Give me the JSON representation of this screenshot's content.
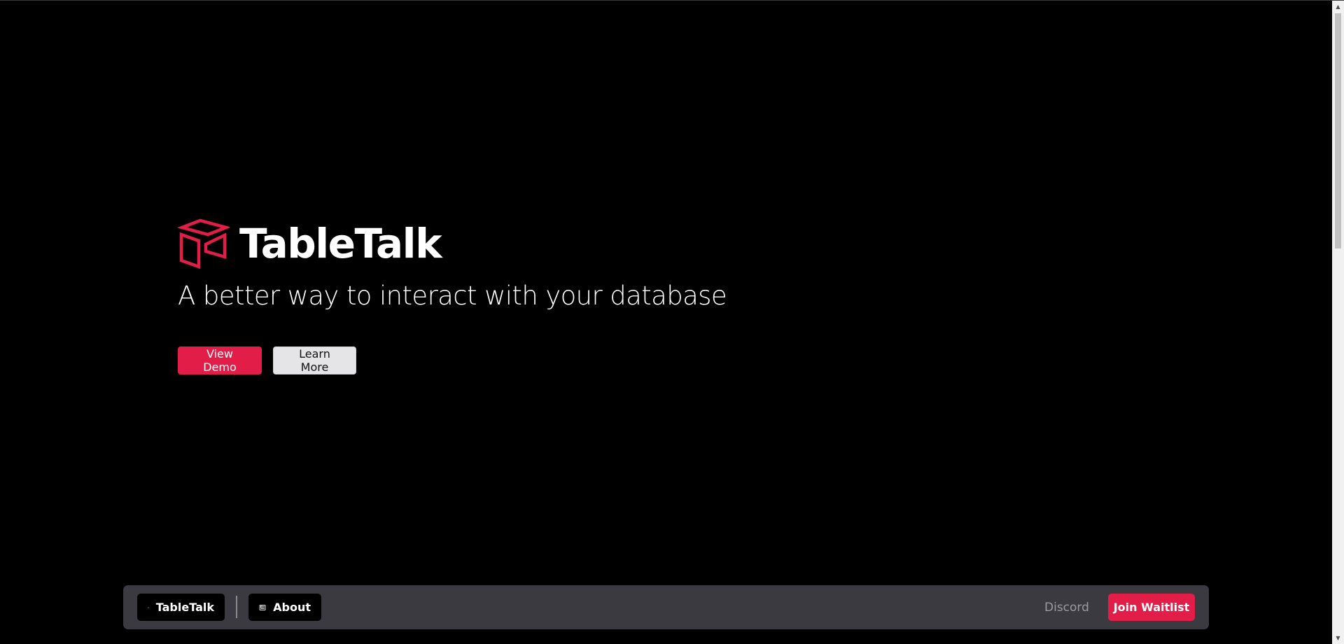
{
  "brand": {
    "name": "TableTalk",
    "logo_icon": "open-box-icon",
    "accent_color": "#e11d48"
  },
  "hero": {
    "tagline": "A better way to interact with your database",
    "primary_button": "View Demo",
    "secondary_button": "Learn More"
  },
  "navbar": {
    "home": {
      "label": "TableTalk",
      "icon": "home-icon"
    },
    "about": {
      "label": "About",
      "icon": "newspaper-icon"
    },
    "discord": "Discord",
    "join": "Join Waitlist",
    "background_color": "#3b3a40"
  },
  "scrollbar": {
    "up_arrow": "▲",
    "down_arrow": "▼"
  }
}
